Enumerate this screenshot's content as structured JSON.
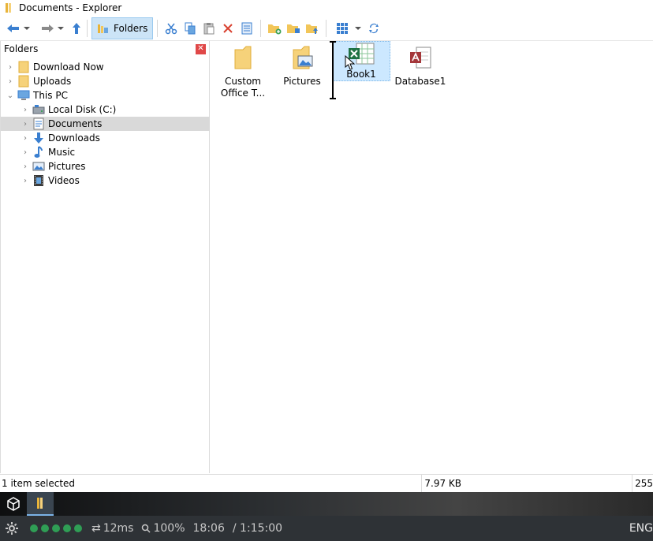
{
  "window": {
    "title": "Documents - Explorer"
  },
  "toolbar": {
    "folders_label": "Folders"
  },
  "sidebar": {
    "header": "Folders",
    "items": [
      {
        "label": "Download Now",
        "icon": "folder-icon",
        "expanded": false
      },
      {
        "label": "Uploads",
        "icon": "folder-icon",
        "expanded": false
      },
      {
        "label": "This PC",
        "icon": "computer-icon",
        "expanded": true
      },
      {
        "label": "Local Disk (C:)",
        "icon": "disk-icon",
        "expanded": false
      },
      {
        "label": "Documents",
        "icon": "documents-icon",
        "expanded": false,
        "selected": true
      },
      {
        "label": "Downloads",
        "icon": "download-arrow-icon",
        "expanded": false
      },
      {
        "label": "Music",
        "icon": "music-note-icon",
        "expanded": false
      },
      {
        "label": "Pictures",
        "icon": "picture-icon",
        "expanded": false
      },
      {
        "label": "Videos",
        "icon": "film-icon",
        "expanded": false
      }
    ]
  },
  "files": [
    {
      "name": "Custom Office T...",
      "icon": "folder-icon"
    },
    {
      "name": "Pictures",
      "icon": "pictures-folder-icon"
    },
    {
      "name": "Book1",
      "icon": "excel-file-icon",
      "selected": true
    },
    {
      "name": "Database1",
      "icon": "access-file-icon"
    }
  ],
  "status": {
    "selection": "1 item selected",
    "size": "7.97 KB",
    "count": "255"
  },
  "infobar": {
    "latency": "12ms",
    "zoom": "100%",
    "time": "18:06",
    "duration": "/ 1:15:00",
    "language": "ENG"
  },
  "colors": {
    "accent": "#cce4f7",
    "selection": "#cce8ff",
    "status_green": "#2f9e55"
  }
}
